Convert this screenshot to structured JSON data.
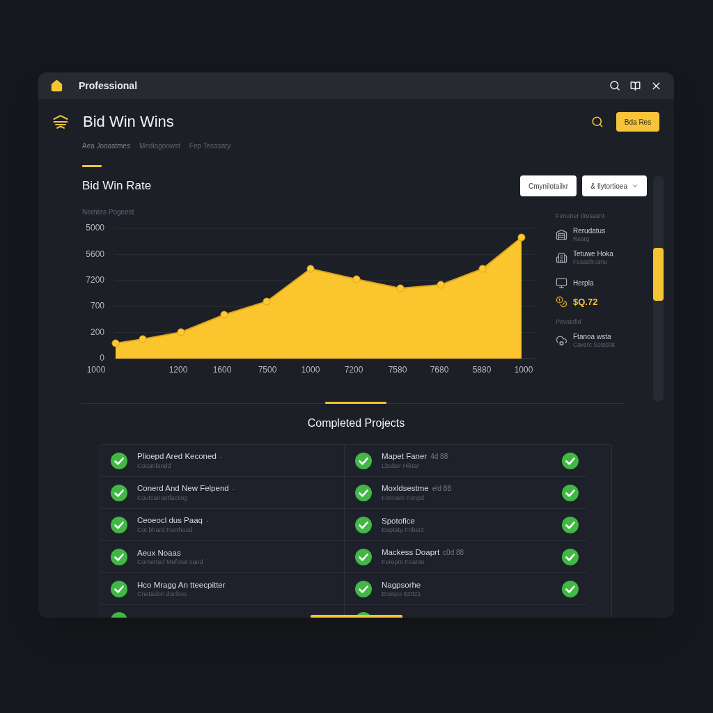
{
  "window": {
    "title": "Professional"
  },
  "header": {
    "title": "Bid Win Wins",
    "button": "Bda Res"
  },
  "tabs": [
    {
      "label": "Aea Jooastmes",
      "selected": true
    },
    {
      "label": "Mediagoowst",
      "selected": false
    },
    {
      "label": "Fep Tecasaty",
      "selected": false
    }
  ],
  "chart_section": {
    "title": "Bid Win Rate",
    "filters": [
      {
        "label": "Cmynilotailxr",
        "dropdown": false
      },
      {
        "label": "& Ilytortioea",
        "dropdown": true
      }
    ],
    "chart": {
      "ylabel": "Nerntes Pogeest",
      "y_axis_labels": [
        "5000",
        "5600",
        "7200",
        "700",
        "200",
        "0"
      ],
      "x_axis_labels": [
        "1000",
        "1200",
        "1600",
        "7500",
        "1000",
        "7200",
        "7580",
        "7680",
        "5880",
        "1000"
      ]
    },
    "legend": [
      {
        "kind": "heading",
        "label": "Fenoner Ilresasnt"
      },
      {
        "kind": "item",
        "label": "Rerudatus",
        "sublabel": "Rearg"
      },
      {
        "kind": "item",
        "label": "Tetuwe Hoka",
        "sublabel": "Fesashrosno"
      },
      {
        "kind": "item",
        "label": "Herpla"
      },
      {
        "kind": "value",
        "label": "$Q.72"
      },
      {
        "kind": "heading",
        "label": "Peviasfid"
      },
      {
        "kind": "item",
        "label": "Ftanoa wsta",
        "sublabel": "Caverc Sotaslat"
      }
    ]
  },
  "completed": {
    "title": "Completed Projects",
    "rows": [
      {
        "left": {
          "title": "Plioepd Ared Keconed",
          "meta": "-",
          "subtitle": "Cooanlandd",
          "completed": true
        },
        "right": {
          "title": "Mapet Faner",
          "meta": "4d 88",
          "subtitle": "Lbuber Hiktar",
          "completed": true,
          "verified": true
        }
      },
      {
        "left": {
          "title": "Conerd And New Felpend",
          "meta": "-",
          "subtitle": "Coutcanoetfacting",
          "completed": true
        },
        "right": {
          "title": "Moxldsestme",
          "meta": "eld 88",
          "subtitle": "Fevroen Fonpd",
          "completed": true,
          "verified": true
        }
      },
      {
        "left": {
          "title": "Ceoeocl dus Paaq",
          "meta": "-",
          "subtitle": "Cot bhard Fecthood",
          "completed": true
        },
        "right": {
          "title": "Spotofice",
          "subtitle": "Eeptaty Fnberz",
          "completed": true,
          "verified": true
        }
      },
      {
        "left": {
          "title": "Aeux Noaas",
          "subtitle": "Comerted Meforat cand",
          "completed": true
        },
        "right": {
          "title": "Mackess Doaprt",
          "meta": "c0d 88",
          "subtitle": "Ferepm Foante",
          "completed": true,
          "verified": true
        }
      },
      {
        "left": {
          "title": "Hco Mragg An tteecpitter",
          "subtitle": "Cnetadon docboo",
          "completed": true
        },
        "right": {
          "title": "Nagpsorhe",
          "subtitle": "Eranpo 63021",
          "completed": true,
          "verified": true
        }
      }
    ],
    "cut_off_row": {
      "left": {
        "completed": true
      },
      "right": {
        "completed": true
      }
    }
  }
}
